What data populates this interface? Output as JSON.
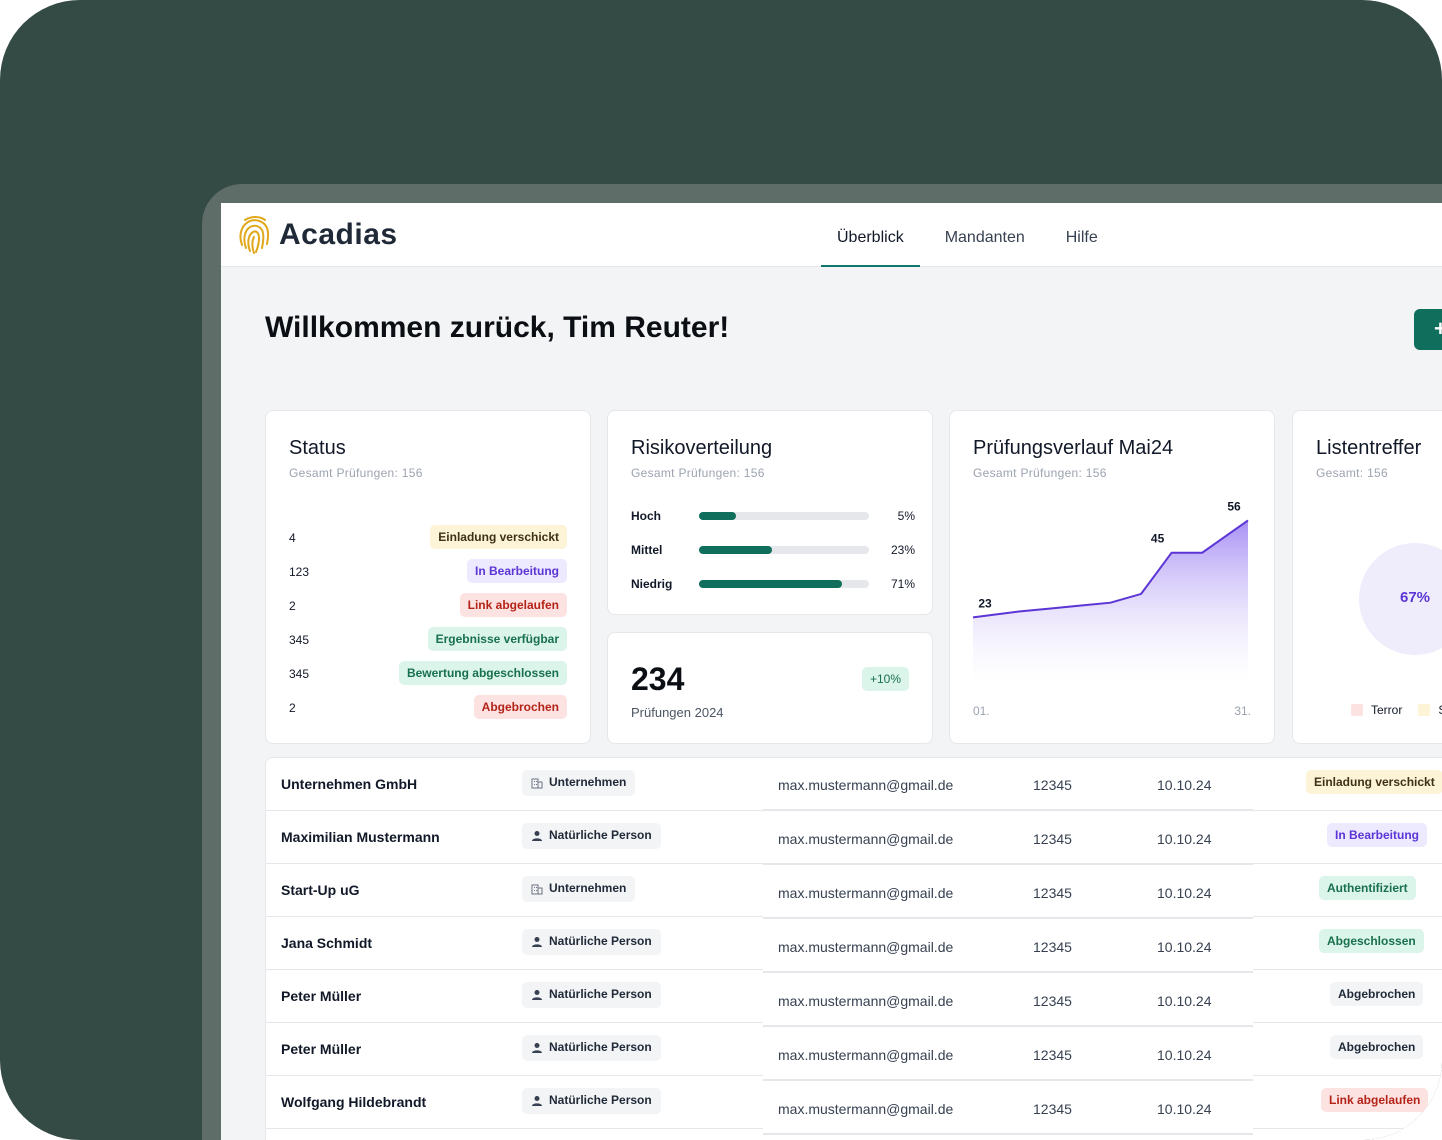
{
  "app": {
    "name": "Acadias"
  },
  "nav": [
    {
      "label": "Überblick",
      "active": true
    },
    {
      "label": "Mandanten",
      "active": false
    },
    {
      "label": "Hilfe",
      "active": false
    }
  ],
  "welcome": "Willkommen zurück, Tim Reuter!",
  "new_button": {
    "label": "+"
  },
  "status_card": {
    "title": "Status",
    "subtitle": "Gesamt Prüfungen: 156",
    "rows": [
      {
        "count": "4",
        "label": "Einladung verschickt",
        "color": "yellow"
      },
      {
        "count": "123",
        "label": "In Bearbeitung",
        "color": "purple"
      },
      {
        "count": "2",
        "label": "Link abgelaufen",
        "color": "red"
      },
      {
        "count": "345",
        "label": "Ergebnisse verfügbar",
        "color": "green"
      },
      {
        "count": "345",
        "label": "Bewertung abgeschlossen",
        "color": "green"
      },
      {
        "count": "2",
        "label": "Abgebrochen",
        "color": "red"
      }
    ]
  },
  "risk_card": {
    "title": "Risikoverteilung",
    "subtitle": "Gesamt Prüfungen: 156",
    "rows": [
      {
        "label": "Hoch",
        "value": 0.22,
        "pct": "5%"
      },
      {
        "label": "Mittel",
        "value": 0.43,
        "pct": "23%"
      },
      {
        "label": "Niedrig",
        "value": 0.84,
        "pct": "71%"
      }
    ]
  },
  "kpi_card": {
    "value": "234",
    "label": "Prüfungen 2024",
    "delta": "+10%"
  },
  "history_card": {
    "title": "Prüfungsverlauf Mai24",
    "subtitle": "Gesamt Prüfungen: 156"
  },
  "chart_data": {
    "type": "area",
    "x": [
      1,
      4,
      6,
      8,
      10,
      12,
      14,
      16,
      19
    ],
    "values": [
      23,
      25,
      26,
      27,
      28,
      31,
      45,
      45,
      56
    ],
    "point_labels": [
      {
        "x": 1,
        "text": "23"
      },
      {
        "x": 14,
        "text": "45"
      },
      {
        "x": 19,
        "text": "56"
      }
    ],
    "x_tick_labels": [
      "01.",
      "31."
    ],
    "ylim": [
      0,
      66
    ],
    "color": "#5b35d5"
  },
  "lists_card": {
    "title": "Listentreffer",
    "subtitle": "Gesamt: 156",
    "donut_value": "67%",
    "legend": [
      {
        "label": "Terror",
        "color": "#fde2e2"
      },
      {
        "label": "S",
        "color": "#fdf3d7"
      }
    ]
  },
  "table": {
    "rows": [
      {
        "name": "Unternehmen GmbH",
        "type": "Unternehmen",
        "type_icon": "building-icon",
        "email": "max.mustermann@gmail.de",
        "number": "12345",
        "date": "10.10.24",
        "status": "Einladung verschickt",
        "status_color": "yellow"
      },
      {
        "name": "Maximilian Mustermann",
        "type": "Natürliche Person",
        "type_icon": "person-icon",
        "email": "max.mustermann@gmail.de",
        "number": "12345",
        "date": "10.10.24",
        "status": "In Bearbeitung",
        "status_color": "purple"
      },
      {
        "name": "Start-Up uG",
        "type": "Unternehmen",
        "type_icon": "building-icon",
        "email": "max.mustermann@gmail.de",
        "number": "12345",
        "date": "10.10.24",
        "status": "Authentifiziert",
        "status_color": "green"
      },
      {
        "name": "Jana Schmidt",
        "type": "Natürliche Person",
        "type_icon": "person-icon",
        "email": "max.mustermann@gmail.de",
        "number": "12345",
        "date": "10.10.24",
        "status": "Abgeschlossen",
        "status_color": "green"
      },
      {
        "name": "Peter Müller",
        "type": "Natürliche Person",
        "type_icon": "person-icon",
        "email": "max.mustermann@gmail.de",
        "number": "12345",
        "date": "10.10.24",
        "status": "Abgebrochen",
        "status_color": "gray"
      },
      {
        "name": "Peter Müller",
        "type": "Natürliche Person",
        "type_icon": "person-icon",
        "email": "max.mustermann@gmail.de",
        "number": "12345",
        "date": "10.10.24",
        "status": "Abgebrochen",
        "status_color": "gray"
      },
      {
        "name": "Wolfgang Hildebrandt",
        "type": "Natürliche Person",
        "type_icon": "person-icon",
        "email": "max.mustermann@gmail.de",
        "number": "12345",
        "date": "10.10.24",
        "status": "Link abgelaufen",
        "status_color": "red"
      }
    ]
  }
}
